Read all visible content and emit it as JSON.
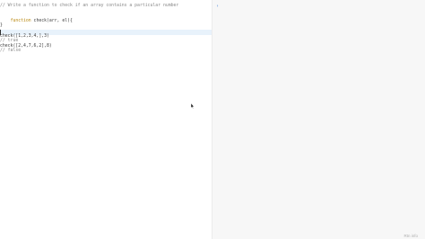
{
  "editor": {
    "comment_line": "// Write a function to check if an array contains a particular number",
    "func_keyword": "function",
    "func_signature": " check(arr, el){",
    "close_brace": "}",
    "call_1": "check([1,2,3,4,],3)",
    "result_1": "// true",
    "call_2": "check([2,4,7,6,2],8)",
    "result_2": "// false"
  },
  "console": {
    "prompt": "›"
  },
  "footer": {
    "link": "Rtn info"
  },
  "colors": {
    "keyword": "#b8860b",
    "active_line": "#e8f2fb",
    "prompt": "#3b7fd8"
  },
  "icons": {
    "mouse_cursor": "arrow-pointer-icon"
  }
}
